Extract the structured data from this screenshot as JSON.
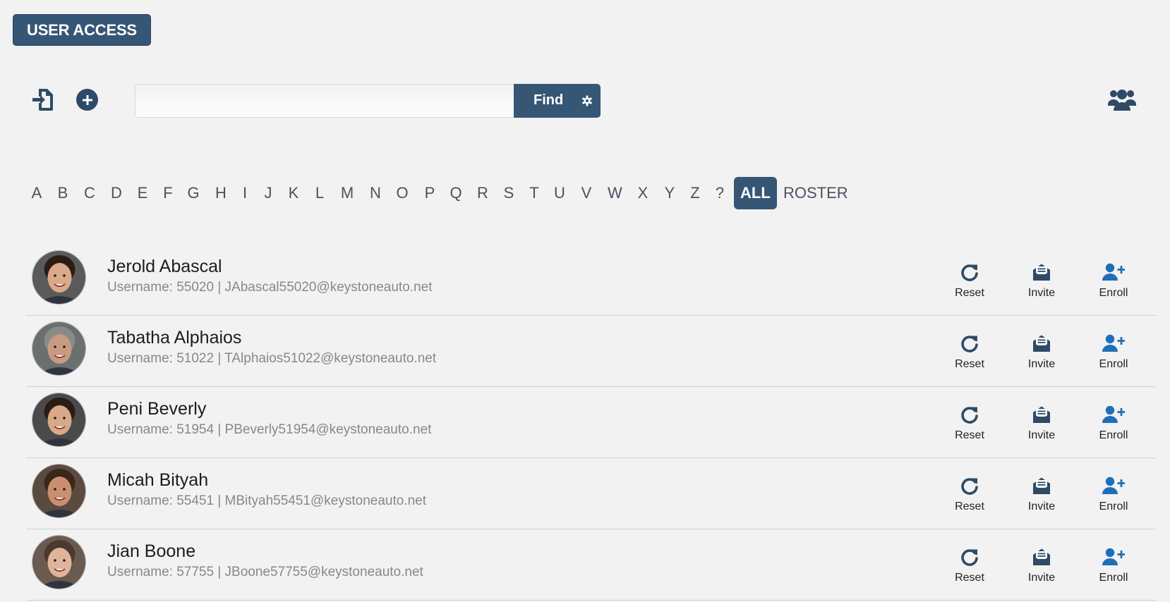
{
  "header": {
    "title": "USER ACCESS"
  },
  "search": {
    "value": "",
    "placeholder": "",
    "find_label": "Find"
  },
  "icons": {
    "import": "file-import-icon",
    "add": "plus-circle-icon",
    "settings": "gear-icon",
    "group": "users-group-icon",
    "reset": "redo-icon",
    "invite": "envelope-open-icon",
    "enroll": "user-plus-icon"
  },
  "colors": {
    "accent": "#365675",
    "enroll": "#1f6fb8",
    "icon_dark": "#2e4a66"
  },
  "alphabet": {
    "letters": [
      "A",
      "B",
      "C",
      "D",
      "E",
      "F",
      "G",
      "H",
      "I",
      "J",
      "K",
      "L",
      "M",
      "N",
      "O",
      "P",
      "Q",
      "R",
      "S",
      "T",
      "U",
      "V",
      "W",
      "X",
      "Y",
      "Z",
      "?"
    ],
    "all_label": "ALL",
    "roster_label": "ROSTER",
    "active": "ALL"
  },
  "actions": {
    "reset": "Reset",
    "invite": "Invite",
    "enroll": "Enroll"
  },
  "users": [
    {
      "name": "Jerold Abascal",
      "meta": "Username: 55020 | JAbascal55020@keystoneauto.net"
    },
    {
      "name": "Tabatha Alphaios",
      "meta": "Username: 51022 | TAlphaios51022@keystoneauto.net"
    },
    {
      "name": "Peni Beverly",
      "meta": "Username: 51954 | PBeverly51954@keystoneauto.net"
    },
    {
      "name": "Micah Bityah",
      "meta": "Username: 55451 | MBityah55451@keystoneauto.net"
    },
    {
      "name": "Jian Boone",
      "meta": "Username: 57755 | JBoone57755@keystoneauto.net"
    }
  ]
}
